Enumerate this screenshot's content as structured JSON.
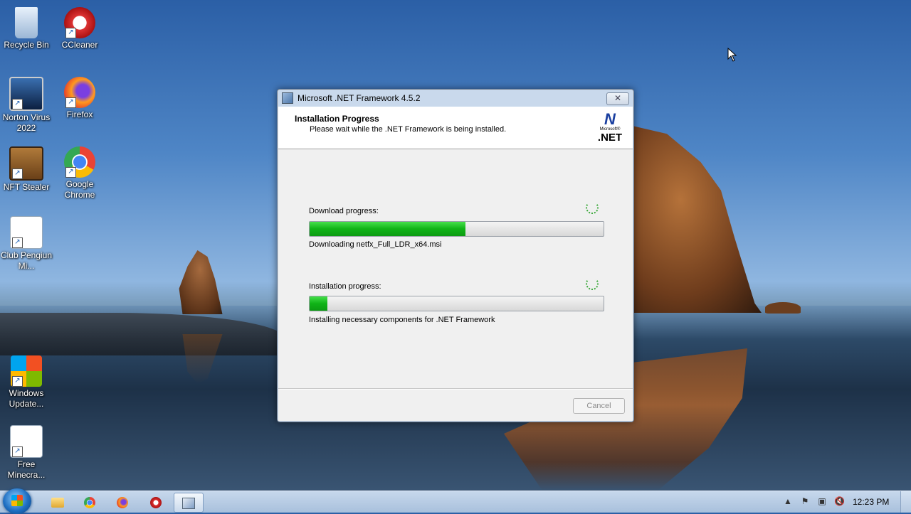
{
  "desktop": {
    "icons": [
      {
        "label": "Recycle Bin"
      },
      {
        "label": "CCleaner"
      },
      {
        "label": "Norton Virus 2022"
      },
      {
        "label": "Firefox"
      },
      {
        "label": "NFT Stealer"
      },
      {
        "label": "Google Chrome"
      },
      {
        "label": "Club Pengiun Mi..."
      },
      {
        "label": "Windows Update..."
      },
      {
        "label": "Free Minecra..."
      }
    ]
  },
  "dialog": {
    "title": "Microsoft .NET Framework 4.5.2",
    "close_glyph": "✕",
    "header_title": "Installation Progress",
    "header_subtitle": "Please wait while the .NET Framework is being installed.",
    "logo_ms": "Microsoft®",
    "logo_net": ".NET",
    "download_label": "Download progress:",
    "download_progress": 0.53,
    "download_status": "Downloading netfx_Full_LDR_x64.msi",
    "install_label": "Installation progress:",
    "install_progress": 0.06,
    "install_status": "Installing necessary components for .NET Framework",
    "cancel_label": "Cancel"
  },
  "taskbar": {
    "pinned": [
      "folder-icon",
      "chrome-icon",
      "firefox-icon",
      "ccleaner-icon",
      "installer-icon"
    ],
    "clock": "12:23 PM"
  },
  "colors": {
    "progress_green": "#10b317",
    "accent": "#1a3fa0"
  }
}
